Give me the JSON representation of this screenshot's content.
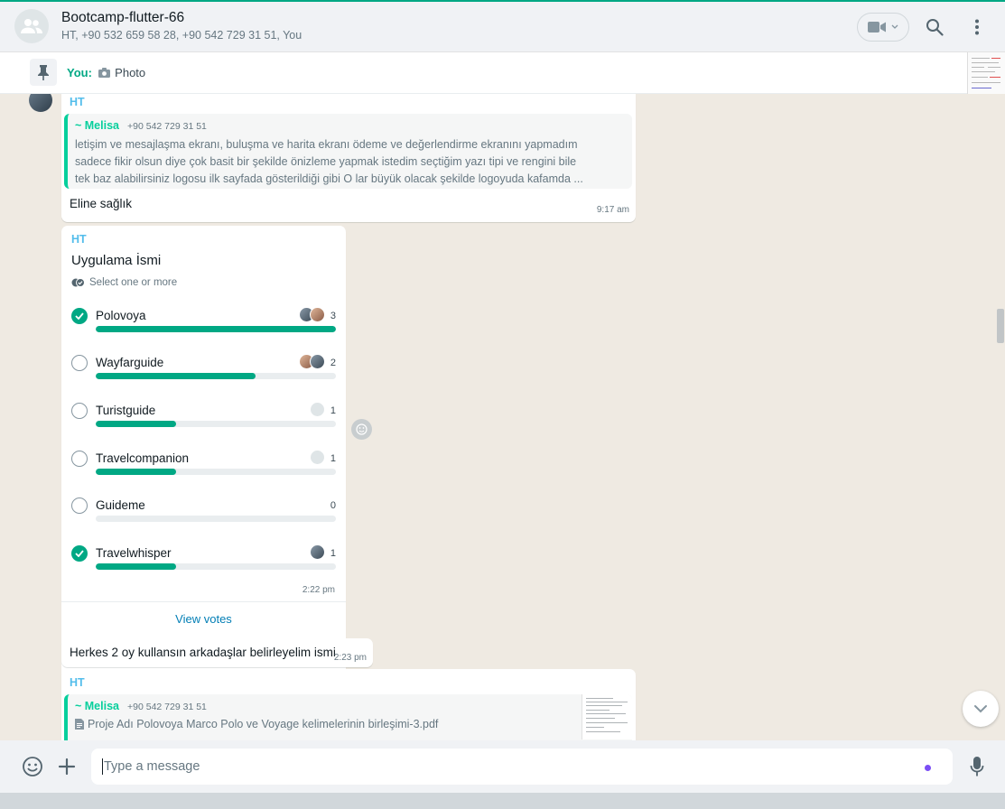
{
  "header": {
    "title": "Bootcamp-flutter-66",
    "subtitle": "HT, +90 532 659 58 28, +90 542 729 31 51, You",
    "video_icon": "video-camera-icon",
    "search_icon": "search-icon",
    "menu_icon": "kebab-menu-icon"
  },
  "pinned": {
    "sender": "You:",
    "text": "Photo",
    "icon": "pin-icon"
  },
  "messages": [
    {
      "sender": "HT",
      "quote_author": "~ Melisa",
      "quote_phone": "+90 542 729 31 51",
      "quote_text": "letişim ve mesajlaşma ekranı, buluşma ve harita ekranı ödeme ve değerlendirme ekranını yapmadım sadece fikir olsun diye çok basit bir şekilde önizleme yapmak istedim seçtiğim yazı tipi ve rengini bile tek baz alabilirsiniz logosu ilk sayfada gösterildiği gibi O lar büyük olacak şekilde logoyuda kafamda ...",
      "text": "Eline sağlık",
      "time": "9:17 am"
    }
  ],
  "poll": {
    "sender": "HT",
    "title": "Uygulama İsmi",
    "subtitle": "Select one or more",
    "time": "2:22 pm",
    "view_votes": "View votes",
    "options": [
      {
        "label": "Polovoya",
        "count": "3",
        "fraction": 1.0,
        "checked": true
      },
      {
        "label": "Wayfarguide",
        "count": "2",
        "fraction": 0.667,
        "checked": false
      },
      {
        "label": "Turistguide",
        "count": "1",
        "fraction": 0.333,
        "checked": false
      },
      {
        "label": "Travelcompanion",
        "count": "1",
        "fraction": 0.333,
        "checked": false
      },
      {
        "label": "Guideme",
        "count": "0",
        "fraction": 0,
        "checked": false
      },
      {
        "label": "Travelwhisper",
        "count": "1",
        "fraction": 0.333,
        "checked": true
      }
    ]
  },
  "message2": {
    "text": "Herkes 2 oy kullansın arkadaşlar belirleyelim ismi",
    "time": "2:23 pm"
  },
  "message3": {
    "sender": "HT",
    "quote_author": "~ Melisa",
    "quote_phone": "+90 542 729 31 51",
    "quote_file": "Proje Adı Polovoya Marco Polo ve Voyage kelimelerinin birleşimi-3.pdf"
  },
  "composer": {
    "placeholder": "Type a message",
    "emoji_icon": "emoji-icon",
    "attach_icon": "plus-icon",
    "mic_icon": "microphone-icon"
  },
  "colors": {
    "accent": "#00a884",
    "link": "#027eb5",
    "sender": "#53bdeb",
    "quote_author": "#06cf9c",
    "background": "#efeae2"
  }
}
